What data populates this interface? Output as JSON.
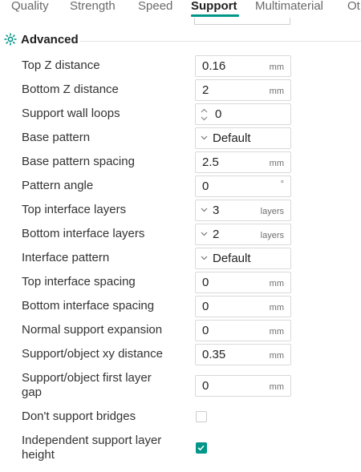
{
  "tabs": [
    {
      "label": "Quality",
      "active": false
    },
    {
      "label": "Strength",
      "active": false
    },
    {
      "label": "Speed",
      "active": false
    },
    {
      "label": "Support",
      "active": true
    },
    {
      "label": "Multimaterial",
      "active": false
    },
    {
      "label": "Ot",
      "active": false
    }
  ],
  "accent_color": "#009688",
  "section": {
    "title": "Advanced",
    "icon": "advanced-settings-icon"
  },
  "settings": [
    {
      "label": "Top Z distance",
      "type": "number",
      "value": "0.16",
      "unit": "mm"
    },
    {
      "label": "Bottom Z distance",
      "type": "number",
      "value": "2",
      "unit": "mm"
    },
    {
      "label": "Support wall loops",
      "type": "spin",
      "value": "0",
      "unit": ""
    },
    {
      "label": "Base pattern",
      "type": "combo",
      "value": "Default",
      "unit": ""
    },
    {
      "label": "Base pattern spacing",
      "type": "number",
      "value": "2.5",
      "unit": "mm"
    },
    {
      "label": "Pattern angle",
      "type": "number",
      "value": "0",
      "unit": "°"
    },
    {
      "label": "Top interface layers",
      "type": "combo",
      "value": "3",
      "unit": "layers"
    },
    {
      "label": "Bottom interface layers",
      "type": "combo",
      "value": "2",
      "unit": "layers"
    },
    {
      "label": "Interface pattern",
      "type": "combo",
      "value": "Default",
      "unit": ""
    },
    {
      "label": "Top interface spacing",
      "type": "number",
      "value": "0",
      "unit": "mm"
    },
    {
      "label": "Bottom interface spacing",
      "type": "number",
      "value": "0",
      "unit": "mm"
    },
    {
      "label": "Normal support expansion",
      "type": "number",
      "value": "0",
      "unit": "mm"
    },
    {
      "label": "Support/object xy distance",
      "type": "number",
      "value": "0.35",
      "unit": "mm"
    },
    {
      "label_lines": [
        "Support/object first layer",
        "gap"
      ],
      "type": "number",
      "value": "0",
      "unit": "mm"
    },
    {
      "label": "Don't support bridges",
      "type": "checkbox",
      "checked": false
    },
    {
      "label_lines": [
        "Independent support layer",
        "height"
      ],
      "type": "checkbox",
      "checked": true
    }
  ]
}
